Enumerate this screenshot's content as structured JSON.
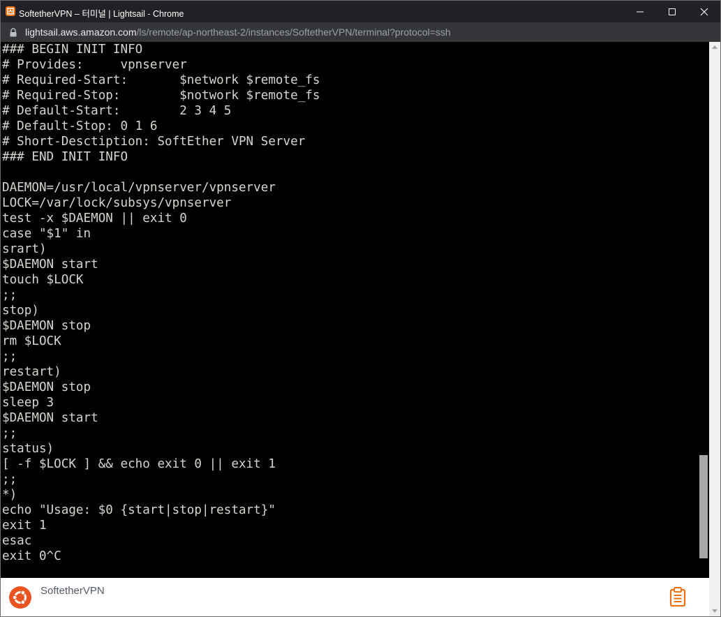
{
  "window": {
    "title": "SoftetherVPN – 터미널 | Lightsail - Chrome",
    "favicon": "aws-lightsail-favicon",
    "controls": {
      "minimize_icon": "minimize-icon",
      "maximize_icon": "maximize-icon",
      "close_icon": "close-icon"
    }
  },
  "address_bar": {
    "lock_icon": "lock-icon",
    "url_host": "lightsail.aws.amazon.com",
    "url_path": "/ls/remote/ap-northeast-2/instances/SoftetherVPN/terminal?protocol=ssh"
  },
  "terminal": {
    "background": "#000000",
    "foreground": "#d3d7cf",
    "lines": [
      "### BEGIN INIT INFO",
      "# Provides:     vpnserver",
      "# Required-Start:       $network $remote_fs",
      "# Required-Stop:        $notwork $remote_fs",
      "# Default-Start:        2 3 4 5",
      "# Default-Stop: 0 1 6",
      "# Short-Desctiption: SoftEther VPN Server",
      "### END INIT INFO",
      "",
      "DAEMON=/usr/local/vpnserver/vpnserver",
      "LOCK=/var/lock/subsys/vpnserver",
      "test -x $DAEMON || exit 0",
      "case \"$1\" in",
      "srart)",
      "$DAEMON start",
      "touch $LOCK",
      ";;",
      "stop)",
      "$DAEMON stop",
      "rm $LOCK",
      ";;",
      "restart)",
      "$DAEMON stop",
      "sleep 3",
      "$DAEMON start",
      ";;",
      "status)",
      "[ -f $LOCK ] && echo exit 0 || exit 1",
      ";;",
      "*)",
      "echo \"Usage: $0 {start|stop|restart}\"",
      "exit 1",
      "esac",
      "exit 0^C"
    ]
  },
  "footer": {
    "os_icon": "ubuntu-logo-icon",
    "instance_name": "SoftetherVPN",
    "clipboard_icon": "clipboard-icon",
    "accent_color": "#e95420"
  }
}
